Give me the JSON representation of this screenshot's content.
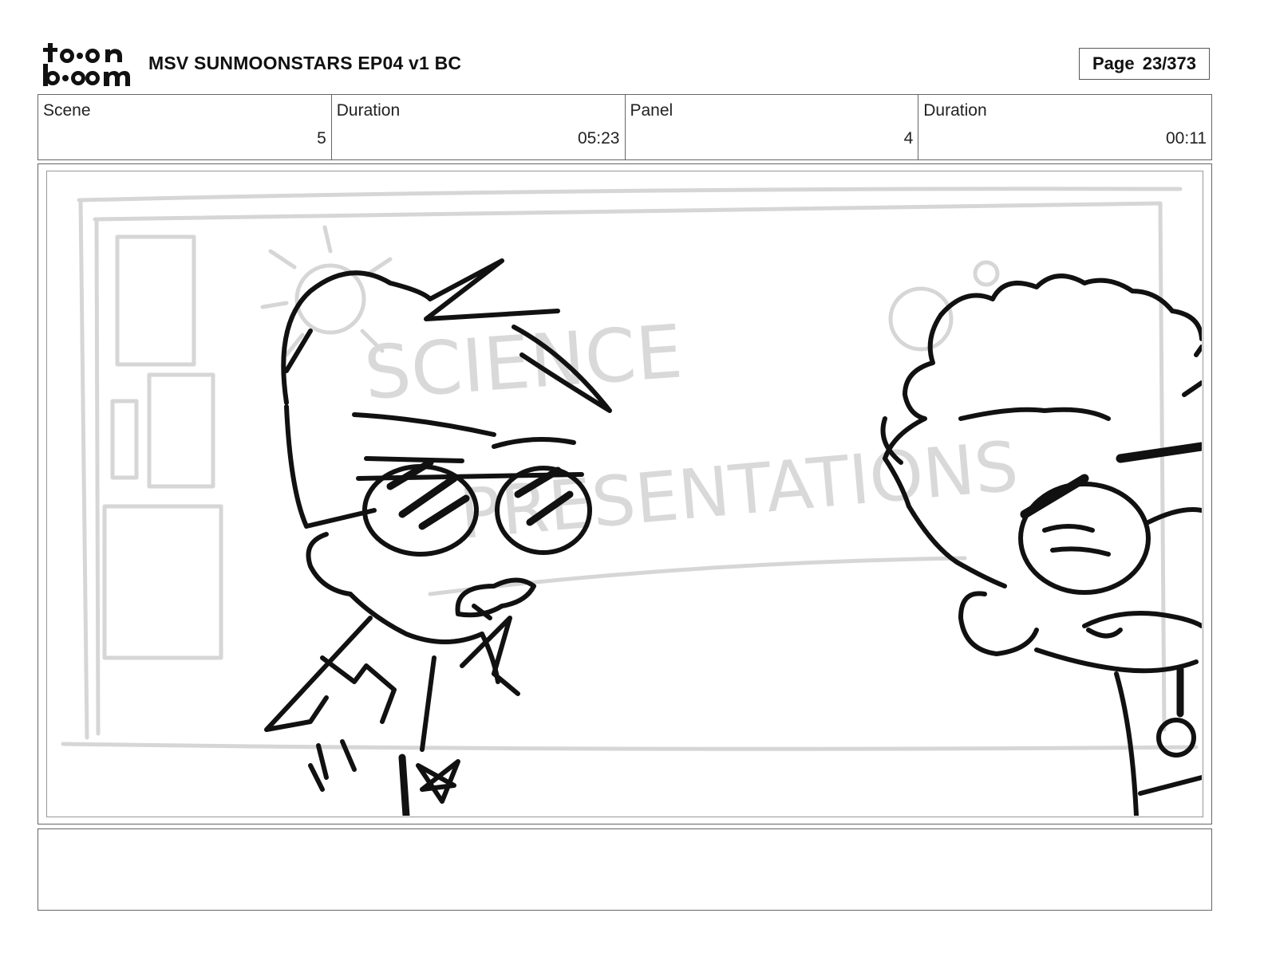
{
  "header": {
    "logo_text_top": "toon",
    "logo_text_bottom": "boom",
    "title": "MSV SUNMOONSTARS EP04 v1 BC",
    "page_label": "Page",
    "page_value": "23/373"
  },
  "info": {
    "scene_label": "Scene",
    "scene_value": "5",
    "scene_duration_label": "Duration",
    "scene_duration_value": "05:23",
    "panel_label": "Panel",
    "panel_value": "4",
    "panel_duration_label": "Duration",
    "panel_duration_value": "00:11"
  },
  "panel": {
    "board_text": "SCIENCE PRESENTATIONS"
  },
  "notes": {
    "text": ""
  }
}
